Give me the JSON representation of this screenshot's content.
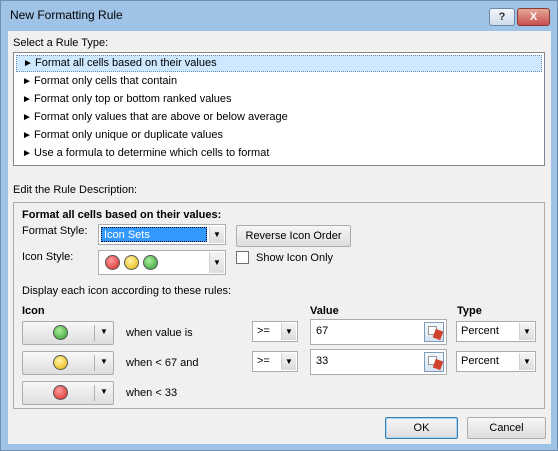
{
  "window": {
    "title": "New Formatting Rule",
    "help_btn": "?",
    "close_btn": "X"
  },
  "rule_type": {
    "heading": "Select a Rule Type:",
    "items": [
      {
        "label": "Format all cells based on their values",
        "selected": true
      },
      {
        "label": "Format only cells that contain"
      },
      {
        "label": "Format only top or bottom ranked values"
      },
      {
        "label": "Format only values that are above or below average"
      },
      {
        "label": "Format only unique or duplicate values"
      },
      {
        "label": "Use a formula to determine which cells to format"
      }
    ]
  },
  "description": {
    "heading": "Edit the Rule Description:",
    "subheading": "Format all cells based on their values:",
    "format_style_label": "Format Style:",
    "format_style_value": "Icon Sets",
    "reverse_button": "Reverse Icon Order",
    "icon_style_label": "Icon Style:",
    "icon_style_colors": [
      "#d42626",
      "#e7b100",
      "#2f9a2b"
    ],
    "show_icon_only_label": "Show Icon Only",
    "show_icon_only_checked": false,
    "rules_heading": "Display each icon according to these rules:",
    "col_icon": "Icon",
    "col_value": "Value",
    "col_type": "Type",
    "rules": [
      {
        "icon": "green-circle",
        "text": "when value is",
        "operator": ">=",
        "value": "67",
        "type": "Percent"
      },
      {
        "icon": "yellow-circle",
        "text": "when < 67 and",
        "operator": ">=",
        "value": "33",
        "type": "Percent"
      },
      {
        "icon": "red-circle",
        "text": "when < 33"
      }
    ]
  },
  "buttons": {
    "ok": "OK",
    "cancel": "Cancel"
  }
}
